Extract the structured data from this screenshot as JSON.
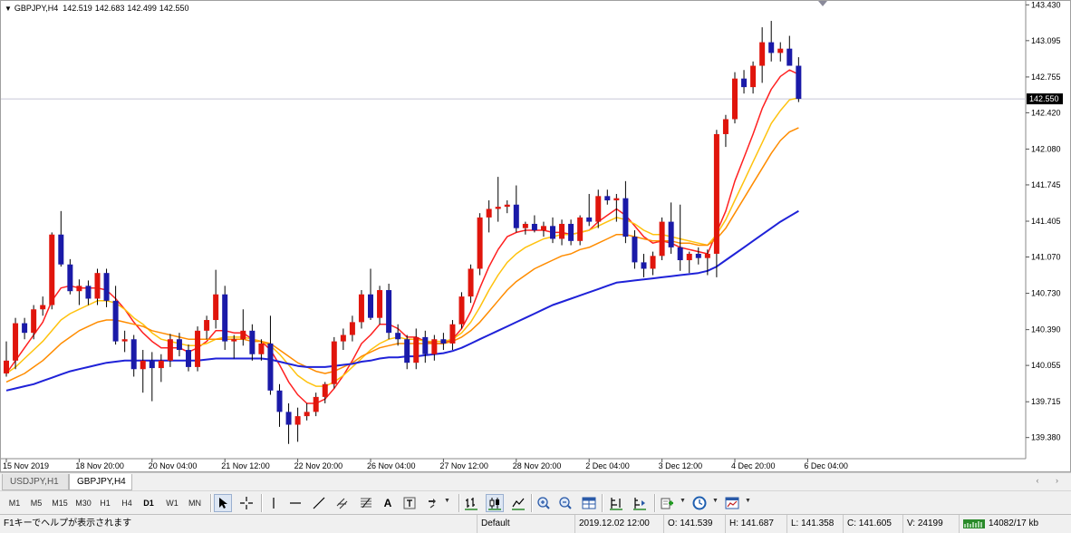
{
  "chart": {
    "symbol": "GBPJPY,H4",
    "open": "142.519",
    "high": "142.683",
    "low": "142.499",
    "close": "142.550",
    "current_price": "142.550",
    "colors": {
      "background": "#ffffff",
      "bull_candle": "#e0150c",
      "bear_candle": "#1a1aa8",
      "wick": "#000000",
      "ma_fast": "#ff2020",
      "ma_mid": "#ffc20e",
      "ma_slow": "#ff8c00",
      "ma_long": "#1f22d8",
      "price_line": "#c8c8d6"
    }
  },
  "chart_data": {
    "type": "candlestick",
    "price_scale": [
      "143.430",
      "143.095",
      "142.755",
      "142.420",
      "142.080",
      "141.745",
      "141.405",
      "141.070",
      "140.730",
      "140.390",
      "140.055",
      "139.715",
      "139.380"
    ],
    "time_labels": [
      "15 Nov 2019",
      "18 Nov 20:00",
      "20 Nov 04:00",
      "21 Nov 12:00",
      "22 Nov 20:00",
      "26 Nov 04:00",
      "27 Nov 12:00",
      "28 Nov 20:00",
      "2 Dec 04:00",
      "3 Dec 12:00",
      "4 Dec 20:00",
      "6 Dec 04:00"
    ],
    "ylim": [
      139.25,
      143.45
    ],
    "bar_count": 88,
    "candles": [
      {
        "o": 139.98,
        "h": 140.28,
        "l": 139.95,
        "c": 140.1
      },
      {
        "o": 140.1,
        "h": 140.5,
        "l": 140.02,
        "c": 140.45
      },
      {
        "o": 140.45,
        "h": 140.5,
        "l": 140.3,
        "c": 140.36
      },
      {
        "o": 140.36,
        "h": 140.62,
        "l": 140.3,
        "c": 140.58
      },
      {
        "o": 140.58,
        "h": 140.7,
        "l": 140.52,
        "c": 140.62
      },
      {
        "o": 140.62,
        "h": 141.3,
        "l": 140.58,
        "c": 141.28
      },
      {
        "o": 141.28,
        "h": 141.5,
        "l": 140.98,
        "c": 141.0
      },
      {
        "o": 141.0,
        "h": 141.05,
        "l": 140.72,
        "c": 140.75
      },
      {
        "o": 140.75,
        "h": 140.86,
        "l": 140.62,
        "c": 140.8
      },
      {
        "o": 140.8,
        "h": 140.85,
        "l": 140.62,
        "c": 140.68
      },
      {
        "o": 140.68,
        "h": 140.96,
        "l": 140.62,
        "c": 140.92
      },
      {
        "o": 140.92,
        "h": 140.96,
        "l": 140.6,
        "c": 140.66
      },
      {
        "o": 140.66,
        "h": 140.8,
        "l": 140.25,
        "c": 140.28
      },
      {
        "o": 140.28,
        "h": 140.38,
        "l": 140.18,
        "c": 140.3
      },
      {
        "o": 140.3,
        "h": 140.34,
        "l": 139.95,
        "c": 140.02
      },
      {
        "o": 140.02,
        "h": 140.2,
        "l": 139.8,
        "c": 140.1
      },
      {
        "o": 140.1,
        "h": 140.18,
        "l": 139.72,
        "c": 140.03
      },
      {
        "o": 140.03,
        "h": 140.16,
        "l": 139.9,
        "c": 140.1
      },
      {
        "o": 140.1,
        "h": 140.35,
        "l": 140.04,
        "c": 140.3
      },
      {
        "o": 140.3,
        "h": 140.36,
        "l": 140.14,
        "c": 140.2
      },
      {
        "o": 140.2,
        "h": 140.25,
        "l": 140.0,
        "c": 140.04
      },
      {
        "o": 140.04,
        "h": 140.42,
        "l": 140.0,
        "c": 140.38
      },
      {
        "o": 140.38,
        "h": 140.52,
        "l": 140.3,
        "c": 140.48
      },
      {
        "o": 140.48,
        "h": 140.95,
        "l": 140.4,
        "c": 140.72
      },
      {
        "o": 140.72,
        "h": 140.8,
        "l": 140.2,
        "c": 140.28
      },
      {
        "o": 140.28,
        "h": 140.34,
        "l": 140.12,
        "c": 140.3
      },
      {
        "o": 140.3,
        "h": 140.58,
        "l": 140.24,
        "c": 140.38
      },
      {
        "o": 140.38,
        "h": 140.44,
        "l": 140.1,
        "c": 140.16
      },
      {
        "o": 140.16,
        "h": 140.3,
        "l": 140.1,
        "c": 140.26
      },
      {
        "o": 140.26,
        "h": 140.52,
        "l": 139.78,
        "c": 139.82
      },
      {
        "o": 139.82,
        "h": 139.88,
        "l": 139.48,
        "c": 139.62
      },
      {
        "o": 139.62,
        "h": 139.7,
        "l": 139.32,
        "c": 139.5
      },
      {
        "o": 139.5,
        "h": 139.66,
        "l": 139.34,
        "c": 139.58
      },
      {
        "o": 139.58,
        "h": 139.7,
        "l": 139.54,
        "c": 139.62
      },
      {
        "o": 139.62,
        "h": 139.8,
        "l": 139.58,
        "c": 139.76
      },
      {
        "o": 139.76,
        "h": 139.9,
        "l": 139.7,
        "c": 139.88
      },
      {
        "o": 139.88,
        "h": 140.32,
        "l": 139.84,
        "c": 140.28
      },
      {
        "o": 140.28,
        "h": 140.4,
        "l": 140.2,
        "c": 140.34
      },
      {
        "o": 140.34,
        "h": 140.52,
        "l": 140.28,
        "c": 140.46
      },
      {
        "o": 140.46,
        "h": 140.76,
        "l": 140.4,
        "c": 140.72
      },
      {
        "o": 140.72,
        "h": 140.96,
        "l": 140.48,
        "c": 140.5
      },
      {
        "o": 140.5,
        "h": 140.8,
        "l": 140.44,
        "c": 140.76
      },
      {
        "o": 140.76,
        "h": 140.82,
        "l": 140.3,
        "c": 140.36
      },
      {
        "o": 140.36,
        "h": 140.44,
        "l": 140.24,
        "c": 140.3
      },
      {
        "o": 140.3,
        "h": 140.34,
        "l": 140.02,
        "c": 140.08
      },
      {
        "o": 140.08,
        "h": 140.4,
        "l": 140.02,
        "c": 140.32
      },
      {
        "o": 140.32,
        "h": 140.38,
        "l": 140.08,
        "c": 140.16
      },
      {
        "o": 140.16,
        "h": 140.34,
        "l": 140.1,
        "c": 140.3
      },
      {
        "o": 140.3,
        "h": 140.36,
        "l": 140.2,
        "c": 140.26
      },
      {
        "o": 140.26,
        "h": 140.48,
        "l": 140.2,
        "c": 140.44
      },
      {
        "o": 140.44,
        "h": 140.74,
        "l": 140.4,
        "c": 140.7
      },
      {
        "o": 140.7,
        "h": 141.0,
        "l": 140.64,
        "c": 140.96
      },
      {
        "o": 140.96,
        "h": 141.48,
        "l": 140.9,
        "c": 141.44
      },
      {
        "o": 141.44,
        "h": 141.6,
        "l": 141.3,
        "c": 141.52
      },
      {
        "o": 141.52,
        "h": 141.82,
        "l": 141.4,
        "c": 141.54
      },
      {
        "o": 141.54,
        "h": 141.6,
        "l": 141.48,
        "c": 141.56
      },
      {
        "o": 141.56,
        "h": 141.74,
        "l": 141.3,
        "c": 141.34
      },
      {
        "o": 141.34,
        "h": 141.4,
        "l": 141.28,
        "c": 141.38
      },
      {
        "o": 141.38,
        "h": 141.46,
        "l": 141.3,
        "c": 141.32
      },
      {
        "o": 141.32,
        "h": 141.4,
        "l": 141.26,
        "c": 141.36
      },
      {
        "o": 141.36,
        "h": 141.44,
        "l": 141.2,
        "c": 141.24
      },
      {
        "o": 141.24,
        "h": 141.42,
        "l": 141.18,
        "c": 141.38
      },
      {
        "o": 141.38,
        "h": 141.42,
        "l": 141.18,
        "c": 141.22
      },
      {
        "o": 141.22,
        "h": 141.46,
        "l": 141.18,
        "c": 141.44
      },
      {
        "o": 141.44,
        "h": 141.66,
        "l": 141.36,
        "c": 141.4
      },
      {
        "o": 141.4,
        "h": 141.7,
        "l": 141.34,
        "c": 141.64
      },
      {
        "o": 141.64,
        "h": 141.7,
        "l": 141.56,
        "c": 141.6
      },
      {
        "o": 141.6,
        "h": 141.66,
        "l": 141.4,
        "c": 141.62
      },
      {
        "o": 141.62,
        "h": 141.78,
        "l": 141.2,
        "c": 141.26
      },
      {
        "o": 141.26,
        "h": 141.32,
        "l": 140.96,
        "c": 141.02
      },
      {
        "o": 141.02,
        "h": 141.1,
        "l": 140.88,
        "c": 140.96
      },
      {
        "o": 140.96,
        "h": 141.12,
        "l": 140.9,
        "c": 141.08
      },
      {
        "o": 141.08,
        "h": 141.44,
        "l": 141.04,
        "c": 141.4
      },
      {
        "o": 141.4,
        "h": 141.58,
        "l": 141.1,
        "c": 141.16
      },
      {
        "o": 141.16,
        "h": 141.56,
        "l": 140.94,
        "c": 141.04
      },
      {
        "o": 141.04,
        "h": 141.12,
        "l": 140.92,
        "c": 141.1
      },
      {
        "o": 141.1,
        "h": 141.16,
        "l": 141.0,
        "c": 141.06
      },
      {
        "o": 141.06,
        "h": 141.14,
        "l": 140.9,
        "c": 141.1
      },
      {
        "o": 141.1,
        "h": 142.26,
        "l": 140.88,
        "c": 142.22
      },
      {
        "o": 142.22,
        "h": 142.4,
        "l": 142.1,
        "c": 142.36
      },
      {
        "o": 142.36,
        "h": 142.8,
        "l": 142.32,
        "c": 142.74
      },
      {
        "o": 142.74,
        "h": 142.82,
        "l": 142.6,
        "c": 142.66
      },
      {
        "o": 142.66,
        "h": 142.9,
        "l": 142.6,
        "c": 142.86
      },
      {
        "o": 142.86,
        "h": 143.22,
        "l": 142.7,
        "c": 143.08
      },
      {
        "o": 143.08,
        "h": 143.28,
        "l": 142.9,
        "c": 142.98
      },
      {
        "o": 142.98,
        "h": 143.08,
        "l": 142.9,
        "c": 143.02
      },
      {
        "o": 143.02,
        "h": 143.14,
        "l": 142.88,
        "c": 142.86
      },
      {
        "o": 142.86,
        "h": 142.94,
        "l": 142.52,
        "c": 142.55
      }
    ],
    "ma_lines": [
      {
        "color": "#ff2020",
        "values": [
          139.98,
          140.1,
          140.22,
          140.34,
          140.46,
          140.66,
          140.78,
          140.8,
          140.78,
          140.78,
          140.78,
          140.76,
          140.68,
          140.58,
          140.46,
          140.36,
          140.28,
          140.22,
          140.22,
          140.22,
          140.18,
          140.22,
          140.28,
          140.38,
          140.38,
          140.36,
          140.36,
          140.3,
          140.28,
          140.2,
          140.06,
          139.9,
          139.78,
          139.7,
          139.7,
          139.74,
          139.84,
          139.96,
          140.1,
          140.26,
          140.34,
          140.44,
          140.44,
          140.4,
          140.32,
          140.32,
          140.28,
          140.26,
          140.26,
          140.3,
          140.4,
          140.56,
          140.78,
          140.98,
          141.14,
          141.26,
          141.3,
          141.32,
          141.32,
          141.32,
          141.3,
          141.3,
          141.28,
          141.3,
          141.32,
          141.4,
          141.46,
          141.52,
          141.46,
          141.36,
          141.26,
          141.2,
          141.22,
          141.2,
          141.16,
          141.14,
          141.12,
          141.1,
          141.3,
          141.5,
          141.78,
          142.0,
          142.22,
          142.46,
          142.64,
          142.76,
          142.82,
          142.78
        ]
      },
      {
        "color": "#ffc20e",
        "values": [
          139.98,
          140.04,
          140.12,
          140.2,
          140.28,
          140.38,
          140.48,
          140.54,
          140.58,
          140.62,
          140.66,
          140.66,
          140.64,
          140.58,
          140.5,
          140.44,
          140.36,
          140.3,
          140.28,
          140.26,
          140.24,
          140.24,
          140.26,
          140.3,
          140.32,
          140.32,
          140.32,
          140.3,
          140.28,
          140.24,
          140.16,
          140.06,
          139.96,
          139.9,
          139.86,
          139.86,
          139.9,
          139.96,
          140.04,
          140.12,
          140.2,
          140.26,
          140.3,
          140.32,
          140.3,
          140.3,
          140.28,
          140.28,
          140.28,
          140.3,
          140.36,
          140.46,
          140.6,
          140.76,
          140.9,
          141.02,
          141.1,
          141.16,
          141.2,
          141.24,
          141.26,
          141.28,
          141.28,
          141.3,
          141.32,
          141.36,
          141.4,
          141.44,
          141.42,
          141.38,
          141.32,
          141.28,
          141.28,
          141.26,
          141.24,
          141.22,
          141.2,
          141.18,
          141.28,
          141.42,
          141.6,
          141.78,
          141.96,
          142.14,
          142.32,
          142.44,
          142.54,
          142.56
        ]
      },
      {
        "color": "#ff8c00",
        "values": [
          139.9,
          139.94,
          139.98,
          140.04,
          140.1,
          140.18,
          140.26,
          140.32,
          140.38,
          140.42,
          140.46,
          140.48,
          140.48,
          140.46,
          140.44,
          140.42,
          140.38,
          140.36,
          140.34,
          140.32,
          140.3,
          140.3,
          140.3,
          140.3,
          140.3,
          140.3,
          140.3,
          140.28,
          140.28,
          140.26,
          140.2,
          140.14,
          140.08,
          140.04,
          140.0,
          139.98,
          140.0,
          140.04,
          140.08,
          140.14,
          140.18,
          140.22,
          140.24,
          140.26,
          140.26,
          140.26,
          140.26,
          140.26,
          140.26,
          140.28,
          140.32,
          140.38,
          140.46,
          140.56,
          140.66,
          140.76,
          140.84,
          140.9,
          140.96,
          141.0,
          141.04,
          141.08,
          141.1,
          141.14,
          141.16,
          141.2,
          141.24,
          141.28,
          141.28,
          141.26,
          141.24,
          141.22,
          141.22,
          141.22,
          141.2,
          141.2,
          141.18,
          141.18,
          141.24,
          141.34,
          141.48,
          141.62,
          141.76,
          141.9,
          142.04,
          142.16,
          142.24,
          142.28
        ]
      },
      {
        "color": "#1f22d8",
        "values": [
          139.82,
          139.84,
          139.86,
          139.88,
          139.91,
          139.94,
          139.97,
          140.0,
          140.02,
          140.04,
          140.06,
          140.08,
          140.09,
          140.1,
          140.1,
          140.1,
          140.1,
          140.1,
          140.1,
          140.1,
          140.1,
          140.1,
          140.11,
          140.12,
          140.12,
          140.12,
          140.12,
          140.12,
          140.12,
          140.11,
          140.09,
          140.07,
          140.05,
          140.04,
          140.04,
          140.04,
          140.05,
          140.06,
          140.07,
          140.09,
          140.1,
          140.12,
          140.13,
          140.13,
          140.14,
          140.14,
          140.15,
          140.16,
          140.17,
          140.19,
          140.22,
          140.26,
          140.3,
          140.34,
          140.38,
          140.42,
          140.46,
          140.5,
          140.54,
          140.58,
          140.62,
          140.65,
          140.68,
          140.71,
          140.74,
          140.77,
          140.8,
          140.83,
          140.84,
          140.85,
          140.86,
          140.87,
          140.88,
          140.89,
          140.9,
          140.91,
          140.92,
          140.94,
          140.98,
          141.04,
          141.1,
          141.16,
          141.22,
          141.28,
          141.34,
          141.4,
          141.45,
          141.5
        ]
      }
    ]
  },
  "tabs": [
    {
      "label": "USDJPY,H1",
      "active": false
    },
    {
      "label": "GBPJPY,H4",
      "active": true
    }
  ],
  "tab_scroll": "‹ ›",
  "toolbar": {
    "timeframes": [
      "M1",
      "M5",
      "M15",
      "M30",
      "H1",
      "H4",
      "D1",
      "W1",
      "MN"
    ],
    "active_timeframe": "D1",
    "line_text_label": "A",
    "text_label_icon": "T"
  },
  "status": {
    "help": "F1キーでヘルプが表示されます",
    "profile": "Default",
    "datetime": "2019.12.02 12:00",
    "open": "O: 141.539",
    "high": "H: 141.687",
    "low": "L: 141.358",
    "close": "C: 141.605",
    "volume": "V: 24199",
    "traffic": "14082/17 kb"
  }
}
